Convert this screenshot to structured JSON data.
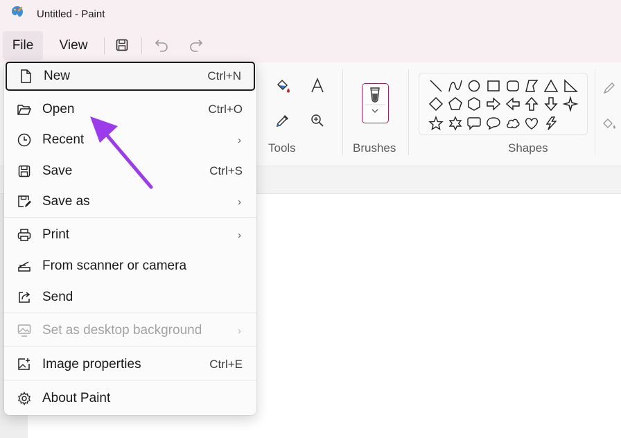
{
  "window": {
    "title": "Untitled - Paint",
    "app_icon": "paint-palette-icon"
  },
  "menubar": {
    "file_label": "File",
    "view_label": "View",
    "save_icon": "save-icon",
    "undo_icon": "undo-icon",
    "redo_icon": "redo-icon"
  },
  "ribbon": {
    "tools_label": "Tools",
    "brushes_label": "Brushes",
    "shapes_label": "Shapes",
    "tools": [
      "fill-bucket-icon",
      "text-icon",
      "color-picker-icon",
      "magnifier-icon"
    ],
    "shapes": [
      "line",
      "curve",
      "oval",
      "rectangle",
      "rounded-rectangle",
      "polygon",
      "triangle",
      "right-triangle",
      "diamond",
      "pentagon",
      "hexagon",
      "right-arrow",
      "left-arrow",
      "up-arrow",
      "down-arrow",
      "four-point-star",
      "five-point-star",
      "six-point-star",
      "rounded-callout",
      "oval-callout",
      "cloud-callout",
      "heart",
      "lightning"
    ],
    "accent_color": "#a3205a"
  },
  "file_menu": {
    "items": [
      {
        "label": "New",
        "shortcut": "Ctrl+N",
        "icon": "new-file-icon",
        "submenu": false,
        "disabled": false
      },
      {
        "label": "Open",
        "shortcut": "Ctrl+O",
        "icon": "open-folder-icon",
        "submenu": false,
        "disabled": false
      },
      {
        "label": "Recent",
        "shortcut": "",
        "icon": "clock-icon",
        "submenu": true,
        "disabled": false
      },
      {
        "label": "Save",
        "shortcut": "Ctrl+S",
        "icon": "save-icon",
        "submenu": false,
        "disabled": false
      },
      {
        "label": "Save as",
        "shortcut": "",
        "icon": "save-as-icon",
        "submenu": true,
        "disabled": false
      },
      {
        "label": "Print",
        "shortcut": "",
        "icon": "printer-icon",
        "submenu": true,
        "disabled": false
      },
      {
        "label": "From scanner or camera",
        "shortcut": "",
        "icon": "scanner-icon",
        "submenu": false,
        "disabled": false
      },
      {
        "label": "Send",
        "shortcut": "",
        "icon": "share-icon",
        "submenu": false,
        "disabled": false
      },
      {
        "label": "Set as desktop background",
        "shortcut": "",
        "icon": "desktop-background-icon",
        "submenu": true,
        "disabled": true
      },
      {
        "label": "Image properties",
        "shortcut": "Ctrl+E",
        "icon": "image-properties-icon",
        "submenu": false,
        "disabled": false
      },
      {
        "label": "About Paint",
        "shortcut": "",
        "icon": "gear-icon",
        "submenu": false,
        "disabled": false
      }
    ],
    "chevron": "›"
  },
  "annotation": {
    "arrow_color": "#9b3bea"
  }
}
